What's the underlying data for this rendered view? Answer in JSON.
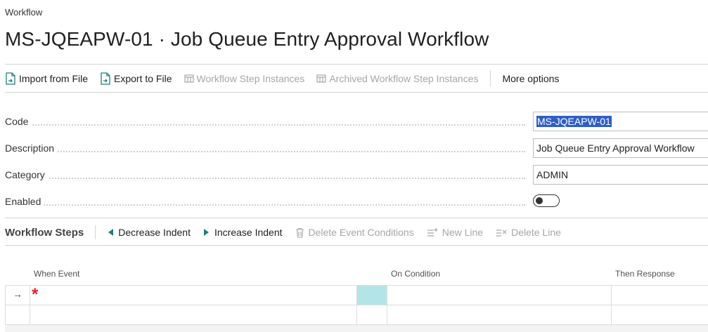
{
  "breadcrumb": "Workflow",
  "page_title": "MS-JQEAPW-01 · Job Queue Entry Approval Workflow",
  "actions": {
    "import_from_file": "Import from File",
    "export_to_file": "Export to File",
    "workflow_step_instances": "Workflow Step Instances",
    "archived_workflow_step_instances": "Archived Workflow Step Instances",
    "more_options": "More options"
  },
  "fields": {
    "code": {
      "label": "Code",
      "value": "MS-JQEAPW-01"
    },
    "description": {
      "label": "Description",
      "value": "Job Queue Entry Approval Workflow"
    },
    "category": {
      "label": "Category",
      "value": "ADMIN"
    },
    "enabled": {
      "label": "Enabled",
      "value": false
    }
  },
  "workflow_steps": {
    "title": "Workflow Steps",
    "actions": {
      "decrease_indent": "Decrease Indent",
      "increase_indent": "Increase Indent",
      "delete_event_conditions": "Delete Event Conditions",
      "new_line": "New Line",
      "delete_line": "Delete Line"
    },
    "columns": {
      "when_event": "When Event",
      "on_condition": "On Condition",
      "then_response": "Then Response"
    },
    "row_marker": "→",
    "required_marker": "*"
  },
  "colors": {
    "selection": "#2f5ec5",
    "accent_icon": "#1b7f7b",
    "highlight_cell": "#b3e5e8",
    "required": "#e8201e"
  }
}
